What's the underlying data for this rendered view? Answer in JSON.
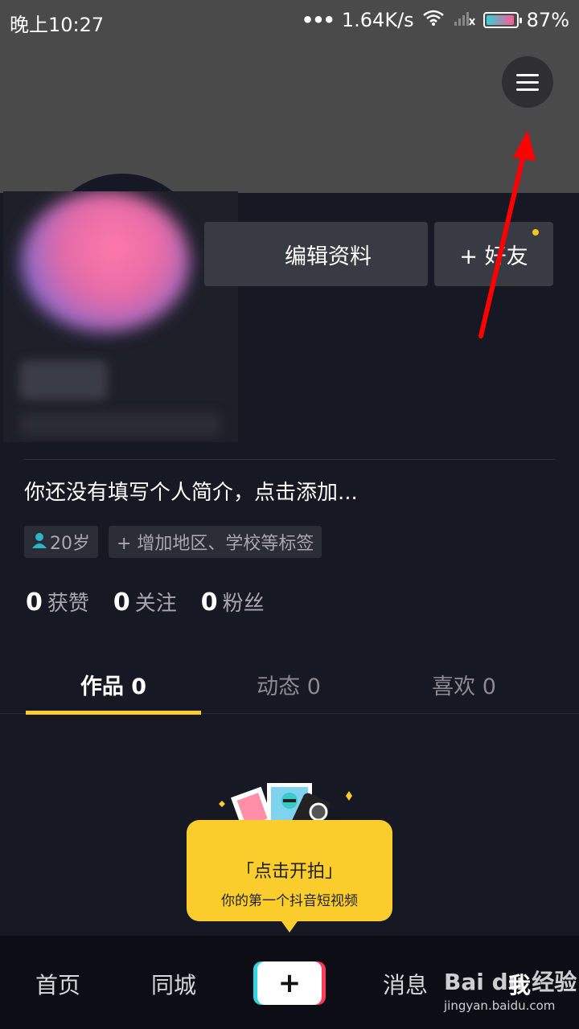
{
  "status_bar": {
    "time": "晚上10:27",
    "dots": "•••",
    "speed": "1.64K/s",
    "battery": "87%"
  },
  "profile": {
    "edit_button": "编辑资料",
    "add_friend_button": "+ 好友",
    "bio": "你还没有填写个人简介，点击添加...",
    "tags": {
      "age": "20岁",
      "add_tag": "+ 增加地区、学校等标签"
    },
    "stats": [
      {
        "num": "0",
        "label": "获赞"
      },
      {
        "num": "0",
        "label": "关注"
      },
      {
        "num": "0",
        "label": "粉丝"
      }
    ]
  },
  "tabs": [
    {
      "label": "作品 0"
    },
    {
      "label": "动态 0"
    },
    {
      "label": "喜欢 0"
    }
  ],
  "shoot_popup": {
    "title": "「点击开拍」",
    "subtitle": "你的第一个抖音短视频"
  },
  "bottom_nav": {
    "home": "首页",
    "city": "同城",
    "create": "+",
    "messages": "消息",
    "me": "我"
  },
  "watermark": {
    "logo": "Bai du 经验",
    "url": "jingyan.baidu.com"
  },
  "colors": {
    "background": "#161823",
    "accent_yellow": "#facc2c",
    "annotation_arrow": "#ff0000"
  }
}
